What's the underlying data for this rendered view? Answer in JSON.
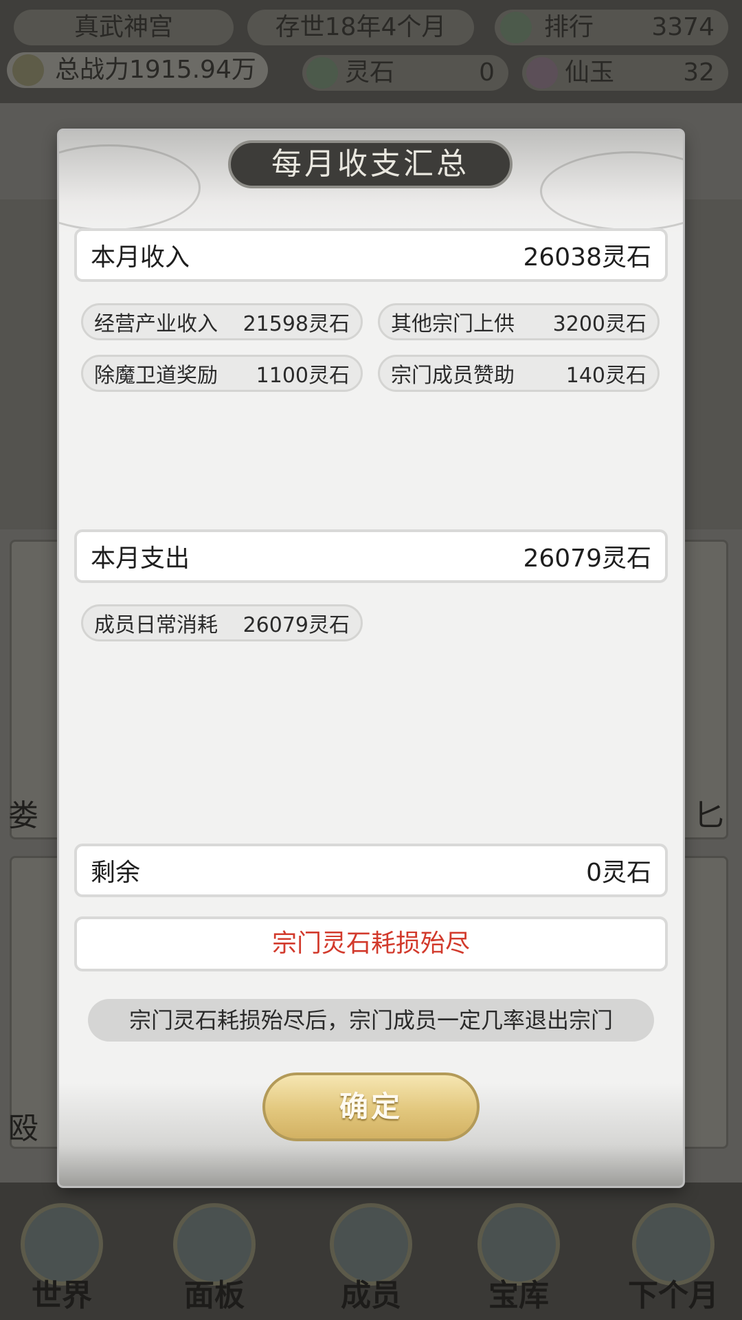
{
  "hud": {
    "sect_name": "真武神宫",
    "age": "存世18年4个月",
    "rank_label": "排行",
    "rank_value": "3374",
    "power": "总战力1915.94万",
    "spirit_stone_label": "灵石",
    "spirit_stone_value": "0",
    "jade_label": "仙玉",
    "jade_value": "32"
  },
  "background_fragments": [
    "娄",
    "殴",
    "匕"
  ],
  "bottom_nav": [
    {
      "label": "世界"
    },
    {
      "label": "面板"
    },
    {
      "label": "成员"
    },
    {
      "label": "宝库"
    },
    {
      "label": "下个月"
    }
  ],
  "dialog": {
    "title": "每月收支汇总",
    "income": {
      "label": "本月收入",
      "total": "26038灵石",
      "items": [
        {
          "name": "经营产业收入",
          "value": "21598灵石"
        },
        {
          "name": "其他宗门上供",
          "value": "3200灵石"
        },
        {
          "name": "除魔卫道奖励",
          "value": "1100灵石"
        },
        {
          "name": "宗门成员赞助",
          "value": "140灵石"
        }
      ]
    },
    "expense": {
      "label": "本月支出",
      "total": "26079灵石",
      "items": [
        {
          "name": "成员日常消耗",
          "value": "26079灵石"
        }
      ]
    },
    "remain": {
      "label": "剩余",
      "value": "0灵石"
    },
    "warning": "宗门灵石耗损殆尽",
    "note": "宗门灵石耗损殆尽后，宗门成员一定几率退出宗门",
    "confirm_label": "确定"
  },
  "colors": {
    "warning": "#d23a2c",
    "confirm_button": "#e2c77d",
    "title_plaque": "#3d3c39"
  }
}
